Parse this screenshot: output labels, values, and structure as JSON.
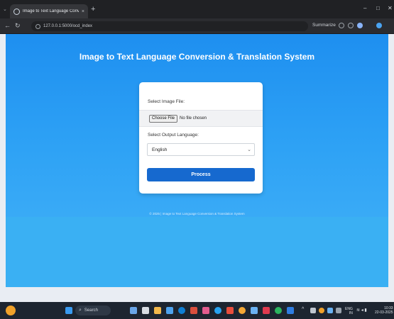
{
  "browser": {
    "tab_title": "Image to Text Language Conversio",
    "tab_close": "×",
    "new_tab": "+",
    "url": "127.0.0.1:5000/ocd_index",
    "summarize_label": "Summarize",
    "window_min": "–",
    "window_max": "□",
    "window_close": "✕"
  },
  "page": {
    "title": "Image to Text Language Conversion & Translation System",
    "form": {
      "image_label": "Select Image File:",
      "choose_file_label": "Choose File",
      "no_file_text": "No file chosen",
      "language_label": "Select Output Language:",
      "selected_language": "English",
      "process_label": "Process"
    },
    "footer": "© 2025 | Image to Text Language Conversion & Translation System"
  },
  "taskbar": {
    "search_label": "Search",
    "language_indicator": "ENG\nIN",
    "time": "10:33",
    "date": "22-03-2025"
  },
  "colors": {
    "gradient_top": "#1e8ff0",
    "gradient_bottom": "#45b3f7",
    "process_button": "#1669cf"
  }
}
